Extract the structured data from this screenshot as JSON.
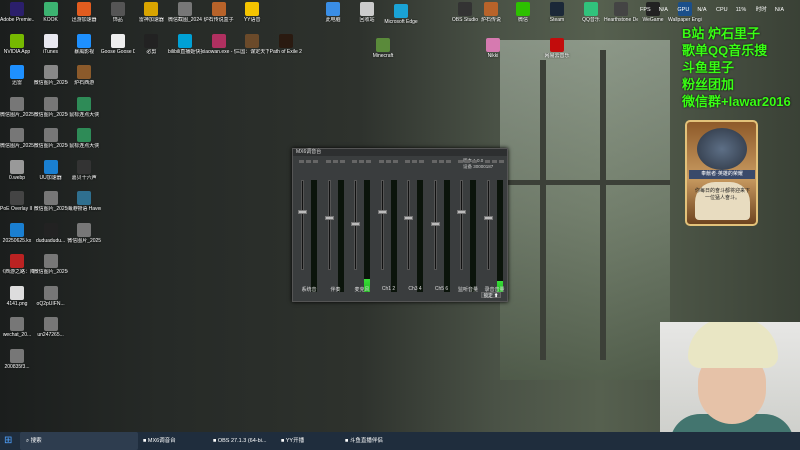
{
  "desktop_icons_left": [
    {
      "label": "Adobe Premie...",
      "color": "#2b1f6b"
    },
    {
      "label": "KOOK",
      "color": "#3cb371"
    },
    {
      "label": "迅游加速器",
      "color": "#e25c1f"
    },
    {
      "label": "饰品",
      "color": "#555"
    },
    {
      "label": "雷神加速器",
      "color": "#d9a400"
    },
    {
      "label": "微信截图_2024071...",
      "color": "#777"
    },
    {
      "label": "炉石传说盒子",
      "color": "#b8632a"
    },
    {
      "label": "YY语音",
      "color": "#f5c400"
    },
    {
      "label": "NVIDIA App",
      "color": "#76b900"
    },
    {
      "label": "iTunes",
      "color": "#e8e8f0"
    },
    {
      "label": "暴風影视",
      "color": "#1e90ff"
    },
    {
      "label": "Goose Goose Duck",
      "color": "#eee"
    },
    {
      "label": "必剪",
      "color": "#222"
    },
    {
      "label": "bilibili直播姬快捷方式",
      "color": "#00a1d6"
    },
    {
      "label": "xiaowan.exe - 快捷方式",
      "color": "#b03060"
    },
    {
      "label": "三国：谋定天下",
      "color": "#6b4a2a"
    },
    {
      "label": "Path of Exile 2",
      "color": "#2a1a10"
    },
    {
      "label": "迅雷",
      "color": "#1e90ff"
    },
    {
      "label": "微信图片_2025072...",
      "color": "#888"
    },
    {
      "label": "炉石西游",
      "color": "#8b5a2b"
    },
    {
      "label": "微信图片_2025020...",
      "color": "#777"
    },
    {
      "label": "微信图片_2025072...",
      "color": "#777"
    },
    {
      "label": "鼠标连点大侠",
      "color": "#2e8b57"
    },
    {
      "label": "微信图片_2025020...",
      "color": "#777"
    },
    {
      "label": "微信图片_2025072...",
      "color": "#777"
    },
    {
      "label": "鼠标连点大侠",
      "color": "#2e8b57"
    },
    {
      "label": "0.webp",
      "color": "#999"
    },
    {
      "label": "UU加速器",
      "color": "#1a7fd1"
    },
    {
      "label": "嘉贝十六声",
      "color": "#333"
    },
    {
      "label": "PoE Overlay II Standal...",
      "color": "#444"
    },
    {
      "label": "微信图片_2025073...",
      "color": "#777"
    },
    {
      "label": "海港物语 Havendock",
      "color": "#2f6f8f"
    },
    {
      "label": "20250625.kx",
      "color": "#1a7fd1"
    },
    {
      "label": "duduadudu...",
      "color": "#222"
    },
    {
      "label": "微信图片_2025062...",
      "color": "#777"
    },
    {
      "label": "《西游之路：降临》签光...",
      "color": "#b22"
    },
    {
      "label": "微信图片_2025091...",
      "color": "#777"
    },
    {
      "label": "4141.png",
      "color": "#ddd"
    },
    {
      "label": "oQ2pUIFN...",
      "color": "#777"
    },
    {
      "label": "wechat_20...",
      "color": "#777"
    },
    {
      "label": "un247265...",
      "color": "#777"
    },
    {
      "label": "200835f3...",
      "color": "#777"
    }
  ],
  "desktop_icons_top": [
    {
      "label": "此电脑",
      "color": "#3a8ee6"
    },
    {
      "label": "回收站",
      "color": "#cccccc"
    },
    {
      "label": "Microsoft Edge",
      "color": "#1aa3d6"
    },
    {
      "label": "OBS Studio",
      "color": "#333"
    },
    {
      "label": "炉石传说",
      "color": "#b8632a"
    },
    {
      "label": "微信",
      "color": "#2dc100"
    },
    {
      "label": "Steam",
      "color": "#1b2838"
    },
    {
      "label": "QQ音乐",
      "color": "#31c27c"
    },
    {
      "label": "Hearthstone Deck Tracker",
      "color": "#444"
    },
    {
      "label": "WeGame",
      "color": "#222"
    },
    {
      "label": "Wallpaper Engine",
      "color": "#1b4f8a"
    },
    {
      "label": "Minecraft",
      "color": "#5a8a3a"
    },
    {
      "label": "Nikki",
      "color": "#d67ab0"
    },
    {
      "label": "网易云音乐",
      "color": "#c20c0c"
    }
  ],
  "stats": {
    "fps": "FPS",
    "fps_val": "N/A",
    "gpu": "GPU",
    "gpu_val": "N/A",
    "cpu": "CPU",
    "cpu_val": "11%",
    "time": "时时",
    "time_val": "N/A"
  },
  "overlay_text": [
    "B站 炉石里子",
    "歌单QQ音乐搜",
    "斗鱼里子",
    "粉丝团加",
    "微信群+lawar2016"
  ],
  "card": {
    "title": "奉献者·英雄的荣耀",
    "text": "你每日的奋斗都将迎来下一位猛人奋斗。"
  },
  "mixer": {
    "title": "MX6调音台",
    "info": [
      "版本 1.0.0",
      "设备 30000187"
    ],
    "lock_label": "锁定 ⬆",
    "channels": [
      {
        "label": "系统音",
        "level": 0.0
      },
      {
        "label": "伴奏",
        "level": 0.0
      },
      {
        "label": "麦克风",
        "level": 0.12
      },
      {
        "label": "Ch1 2",
        "level": 0.0
      },
      {
        "label": "Ch3 4",
        "level": 0.0
      },
      {
        "label": "Ch5 6",
        "level": 0.0
      },
      {
        "label": "监听音量",
        "level": 0.0
      },
      {
        "label": "录音音量",
        "level": 0.1
      }
    ]
  },
  "taskbar": {
    "search": "搜索",
    "items": [
      {
        "label": "MX6调音台",
        "active": false
      },
      {
        "label": "OBS 27.1.3 (64-bi...",
        "active": false
      },
      {
        "label": "YY开播",
        "active": false
      },
      {
        "label": "斗鱼直播伴侣",
        "active": false
      }
    ]
  }
}
